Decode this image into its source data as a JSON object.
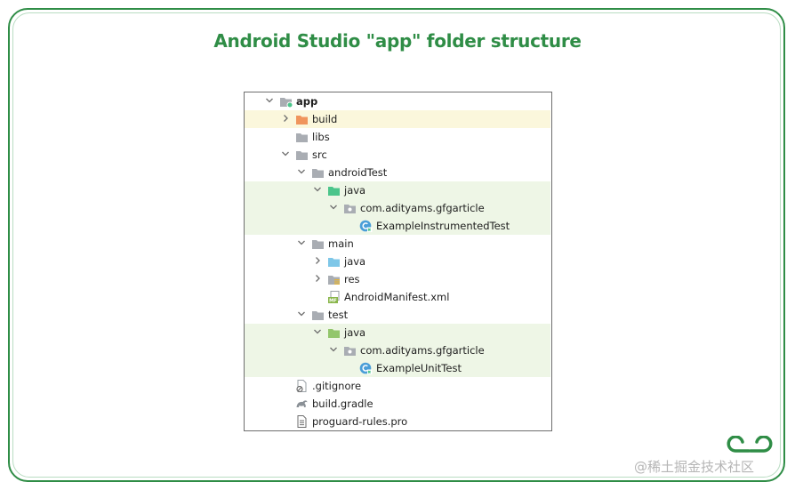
{
  "title": "Android Studio \"app\" folder structure",
  "watermark": "@稀土掘金技术社区",
  "tree": [
    {
      "label": "app",
      "level": 0,
      "chevron": "down",
      "icon": "module-folder-icon",
      "bold": true,
      "hl": ""
    },
    {
      "label": "build",
      "level": 1,
      "chevron": "right",
      "icon": "excluded-folder-icon",
      "hl": "yellow"
    },
    {
      "label": "libs",
      "level": 1,
      "chevron": "",
      "icon": "folder-icon",
      "hl": ""
    },
    {
      "label": "src",
      "level": 1,
      "chevron": "down",
      "icon": "folder-icon",
      "hl": ""
    },
    {
      "label": "androidTest",
      "level": 2,
      "chevron": "down",
      "icon": "folder-icon",
      "hl": ""
    },
    {
      "label": "java",
      "level": 3,
      "chevron": "down",
      "icon": "test-source-folder-icon",
      "hl": "green"
    },
    {
      "label": "com.adityams.gfgarticle",
      "level": 4,
      "chevron": "down",
      "icon": "package-icon",
      "hl": "green"
    },
    {
      "label": "ExampleInstrumentedTest",
      "level": 5,
      "chevron": "",
      "icon": "test-class-icon",
      "hl": "green"
    },
    {
      "label": "main",
      "level": 2,
      "chevron": "down",
      "icon": "folder-icon",
      "hl": ""
    },
    {
      "label": "java",
      "level": 3,
      "chevron": "right",
      "icon": "source-folder-icon",
      "hl": ""
    },
    {
      "label": "res",
      "level": 3,
      "chevron": "right",
      "icon": "resource-folder-icon",
      "hl": ""
    },
    {
      "label": "AndroidManifest.xml",
      "level": 3,
      "chevron": "",
      "icon": "manifest-file-icon",
      "hl": ""
    },
    {
      "label": "test",
      "level": 2,
      "chevron": "down",
      "icon": "folder-icon",
      "hl": ""
    },
    {
      "label": "java",
      "level": 3,
      "chevron": "down",
      "icon": "unit-test-folder-icon",
      "hl": "green"
    },
    {
      "label": "com.adityams.gfgarticle",
      "level": 4,
      "chevron": "down",
      "icon": "package-icon",
      "hl": "green"
    },
    {
      "label": "ExampleUnitTest",
      "level": 5,
      "chevron": "",
      "icon": "test-class-icon",
      "hl": "green"
    },
    {
      "label": ".gitignore",
      "level": 1,
      "chevron": "",
      "icon": "gitignore-file-icon",
      "hl": ""
    },
    {
      "label": "build.gradle",
      "level": 1,
      "chevron": "",
      "icon": "gradle-file-icon",
      "hl": ""
    },
    {
      "label": "proguard-rules.pro",
      "level": 1,
      "chevron": "",
      "icon": "text-file-icon",
      "hl": ""
    }
  ],
  "colors": {
    "brand_green": "#2f8d46",
    "folder_gray": "#a9adb3",
    "excluded_orange": "#f0955d",
    "test_green": "#4bc58b",
    "source_blue": "#7ec7e8",
    "unit_test_green": "#92c66b"
  }
}
